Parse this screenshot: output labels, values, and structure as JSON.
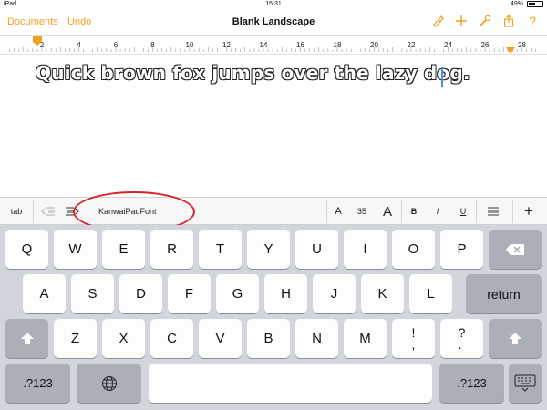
{
  "status_bar": {
    "carrier": "iPad",
    "time": "15:31",
    "battery": "49%",
    "battery_level": 0.49
  },
  "nav": {
    "documents_label": "Documents",
    "undo_label": "Undo",
    "title": "Blank Landscape",
    "icons": [
      "format-brush-icon",
      "add-icon",
      "wrench-icon",
      "share-icon",
      "help-icon"
    ],
    "help_label": "?"
  },
  "ruler": {
    "labels": [
      "2",
      "4",
      "6",
      "8",
      "10",
      "12",
      "14",
      "16",
      "18",
      "20",
      "22",
      "24",
      "26",
      "28"
    ]
  },
  "document": {
    "text": "Quick brown fox jumps over the lazy dog."
  },
  "format_bar": {
    "tab_label": "tab",
    "font_name": "KanwaiPadFont",
    "font_small_label": "A",
    "font_size": "35",
    "font_large_label": "A",
    "bold_label": "B",
    "italic_label": "I",
    "underline_label": "U",
    "plus_label": "+"
  },
  "keyboard": {
    "row1": [
      "Q",
      "W",
      "E",
      "R",
      "T",
      "Y",
      "U",
      "I",
      "O",
      "P"
    ],
    "row2": [
      "A",
      "S",
      "D",
      "F",
      "G",
      "H",
      "J",
      "K",
      "L"
    ],
    "row3": [
      "Z",
      "X",
      "C",
      "V",
      "B",
      "N",
      "M"
    ],
    "return_label": "return",
    "excl_label": "!\n,",
    "question_label": "?\n.",
    "numbers_label": ".?123"
  },
  "colors": {
    "accent": "#f0a020",
    "annotation": "#d8232a",
    "caret": "#4a90e2"
  }
}
